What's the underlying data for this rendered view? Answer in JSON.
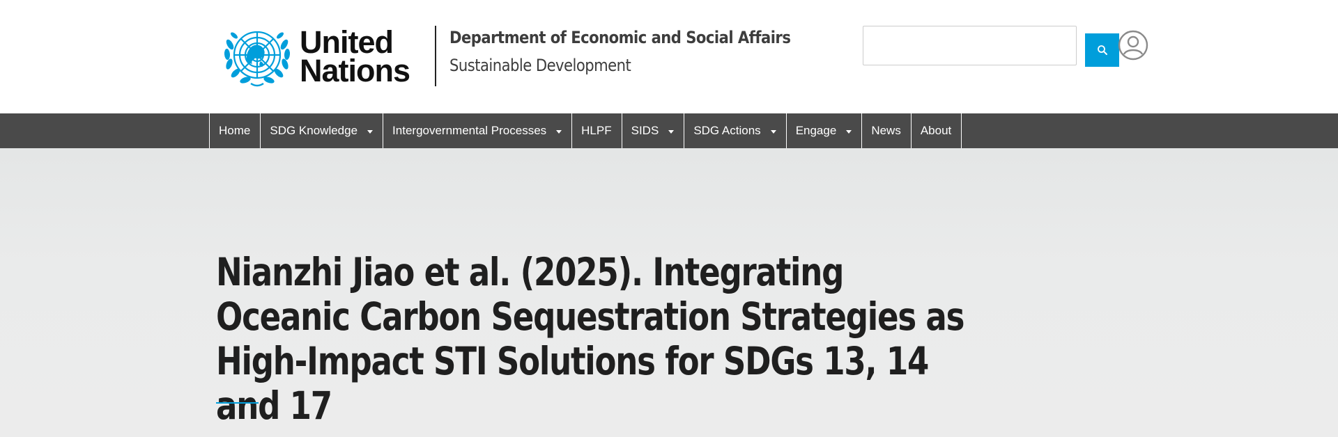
{
  "header": {
    "org_line1": "United",
    "org_line2": "Nations",
    "department": "Department of Economic and Social Affairs",
    "division": "Sustainable Development",
    "search_value": "",
    "icons": {
      "emblem": "un-emblem-icon",
      "search": "search-icon",
      "user": "user-account-icon"
    }
  },
  "nav": {
    "items": [
      {
        "label": "Home",
        "dropdown": false
      },
      {
        "label": "SDG Knowledge",
        "dropdown": true
      },
      {
        "label": "Intergovernmental Processes",
        "dropdown": true
      },
      {
        "label": "HLPF",
        "dropdown": false
      },
      {
        "label": "SIDS",
        "dropdown": true
      },
      {
        "label": "SDG Actions",
        "dropdown": true
      },
      {
        "label": "Engage",
        "dropdown": true
      },
      {
        "label": "News",
        "dropdown": false
      },
      {
        "label": "About",
        "dropdown": false
      }
    ]
  },
  "page": {
    "title": "Nianzhi Jiao et al. (2025). Integrating Oceanic Carbon Sequestration Strategies as High-Impact STI Solutions for SDGs 13, 14 and 17"
  },
  "colors": {
    "un_blue": "#009edb",
    "nav_background": "#4a4a4a",
    "title_text": "#1f1f1f",
    "hero_background": "#eaebeb"
  }
}
